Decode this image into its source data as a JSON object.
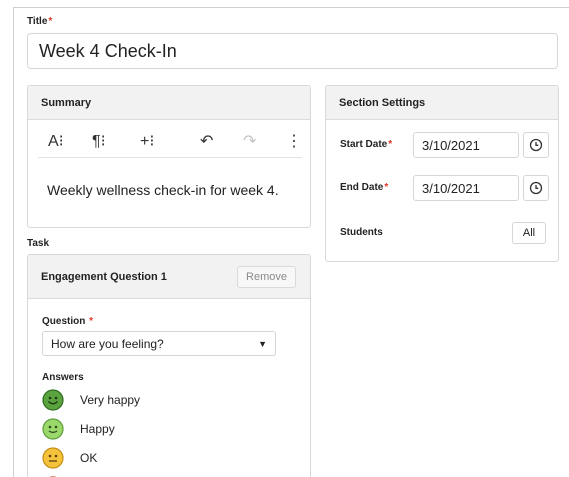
{
  "title_field": {
    "label": "Title",
    "required_mark": "*",
    "value": "Week 4 Check-In"
  },
  "summary": {
    "heading": "Summary",
    "toolbar": [
      "A⁝",
      "¶⁝",
      "+⁝",
      "↶",
      "↷",
      "⋮"
    ],
    "text": "Weekly wellness check-in for week 4."
  },
  "section_settings": {
    "heading": "Section Settings",
    "start_date": {
      "label": "Start Date",
      "required_mark": "*",
      "value": "3/10/2021"
    },
    "end_date": {
      "label": "End Date",
      "required_mark": "*",
      "value": "3/10/2021"
    },
    "students": {
      "label": "Students",
      "button": "All"
    }
  },
  "task": {
    "label": "Task",
    "card_title": "Engagement Question 1",
    "remove_label": "Remove",
    "question": {
      "label": "Question",
      "required_mark": "*",
      "value": "How are you feeling?"
    },
    "answers_label": "Answers",
    "answers": [
      {
        "label": "Very happy",
        "icon": "very-happy-face-icon",
        "color": "#5aa33e"
      },
      {
        "label": "Happy",
        "icon": "happy-face-icon",
        "color": "#9ad86c"
      },
      {
        "label": "OK",
        "icon": "neutral-face-icon",
        "color": "#f5c23c"
      },
      {
        "label": "",
        "icon": "sad-face-icon",
        "color": "#ee7a3a"
      }
    ]
  },
  "colors": {
    "required": "#e0342a",
    "panel_header": "#f2f2f2",
    "border": "#d8d8d8"
  }
}
